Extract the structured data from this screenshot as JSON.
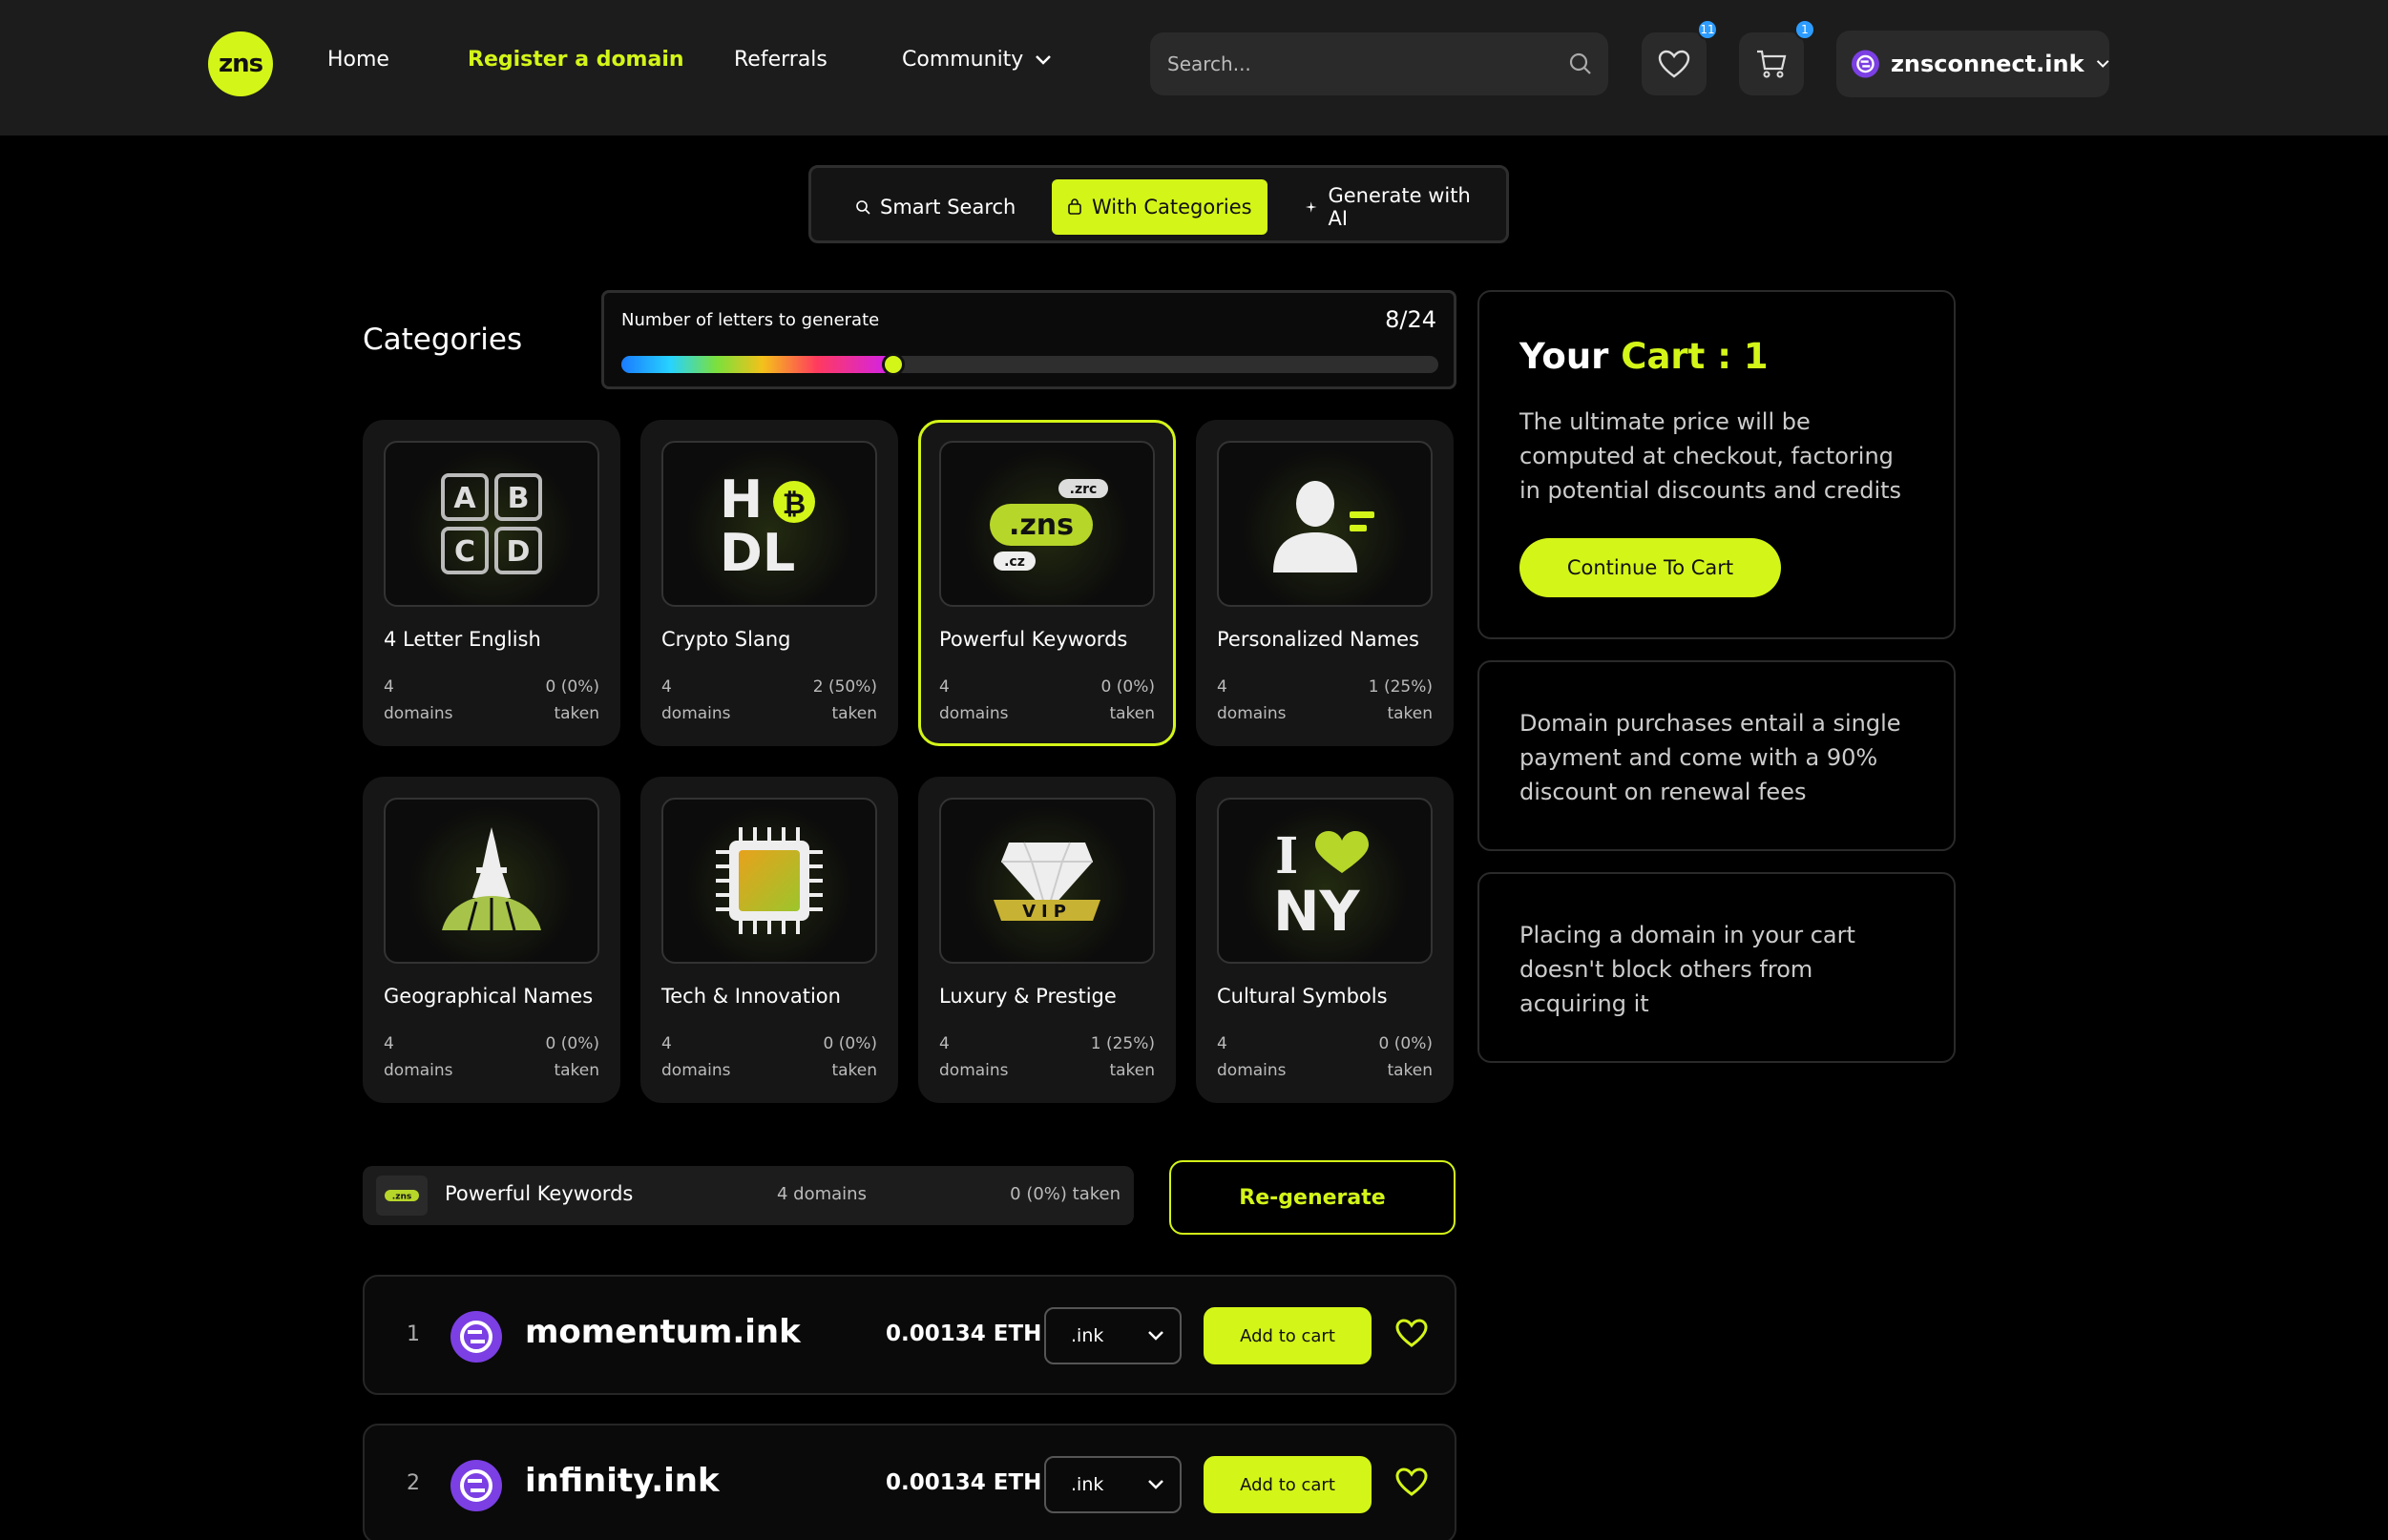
{
  "header": {
    "logo_text": "zns",
    "nav": {
      "home": "Home",
      "register": "Register a domain",
      "referrals": "Referrals",
      "community": "Community"
    },
    "search_placeholder": "Search...",
    "wishlist_count": "11",
    "cart_count": "1",
    "account": "znsconnect.ink"
  },
  "modes": {
    "smart": "Smart Search",
    "categories": "With Categories",
    "ai": "Generate with AI"
  },
  "categories_title": "Categories",
  "slider": {
    "label": "Number of letters to generate",
    "count": "8/24",
    "value": 8,
    "max": 24
  },
  "categories": [
    {
      "name": "4 Letter English",
      "domains": "4",
      "domains_label": "domains",
      "taken": "0 (0%)",
      "taken_label": "taken",
      "icon": "abcd-icon"
    },
    {
      "name": "Crypto Slang",
      "domains": "4",
      "domains_label": "domains",
      "taken": "2 (50%)",
      "taken_label": "taken",
      "icon": "hodl-icon"
    },
    {
      "name": "Powerful Keywords",
      "domains": "4",
      "domains_label": "domains",
      "taken": "0 (0%)",
      "taken_label": "taken",
      "icon": "zns-tld-icon",
      "selected": true
    },
    {
      "name": "Personalized Names",
      "domains": "4",
      "domains_label": "domains",
      "taken": "1 (25%)",
      "taken_label": "taken",
      "icon": "person-icon"
    },
    {
      "name": "Geographical Names",
      "domains": "4",
      "domains_label": "domains",
      "taken": "0 (0%)",
      "taken_label": "taken",
      "icon": "eiffel-tower-icon"
    },
    {
      "name": "Tech & Innovation",
      "domains": "4",
      "domains_label": "domains",
      "taken": "0 (0%)",
      "taken_label": "taken",
      "icon": "chip-icon"
    },
    {
      "name": "Luxury & Prestige",
      "domains": "4",
      "domains_label": "domains",
      "taken": "1 (25%)",
      "taken_label": "taken",
      "icon": "diamond-vip-icon"
    },
    {
      "name": "Cultural Symbols",
      "domains": "4",
      "domains_label": "domains",
      "taken": "0 (0%)",
      "taken_label": "taken",
      "icon": "i-love-ny-icon"
    }
  ],
  "icon_text": {
    "abcd": [
      "A",
      "B",
      "C",
      "D"
    ],
    "hodl_top": "H",
    "hodl_bottom": "DL",
    "tld_top": ".zrc",
    "tld_main": ".zns",
    "tld_bottom": ".cz",
    "vip": "VIP",
    "ny_i": "I",
    "ny": "NY"
  },
  "selected_category": {
    "thumb_text": ".zns",
    "name": "Powerful Keywords",
    "domains": "4 domains",
    "taken": "0 (0%) taken"
  },
  "regenerate_label": "Re-generate",
  "domains": [
    {
      "index": "1",
      "name": "momentum.ink",
      "price": "0.00134 ETH",
      "tld": ".ink",
      "add_label": "Add to cart"
    },
    {
      "index": "2",
      "name": "infinity.ink",
      "price": "0.00134 ETH",
      "tld": ".ink",
      "add_label": "Add to cart"
    }
  ],
  "cart": {
    "title_prefix": "Your ",
    "title_highlight": "Cart : 1",
    "description": "The ultimate price will be computed at checkout, factoring in potential discounts and credits",
    "button": "Continue To Cart"
  },
  "info": [
    "Domain purchases entail a single payment and come with a 90% discount on renewal fees",
    "Placing a domain in your cart doesn't block others from acquiring it"
  ],
  "colors": {
    "accent": "#d4f518",
    "badge": "#2d9cff",
    "ink_purple": "#7b3fe4"
  }
}
